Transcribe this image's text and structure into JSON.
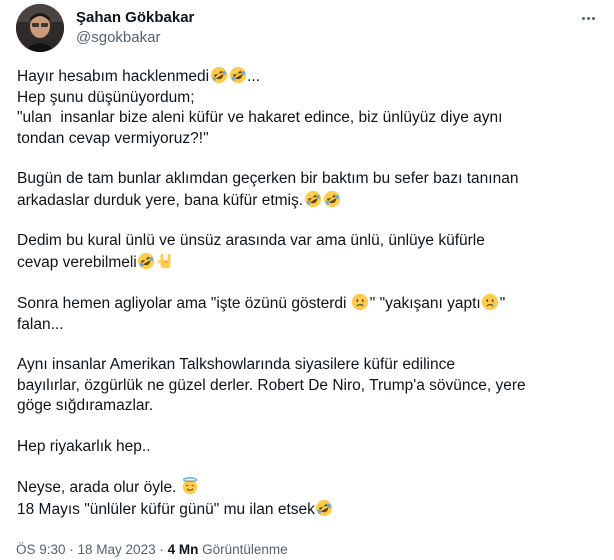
{
  "author": {
    "display_name": "Şahan Gökbakar",
    "handle": "@sgokbakar"
  },
  "tweet": {
    "paragraphs": [
      {
        "lines": [
          [
            {
              "t": "Hayır hesabım hacklenmedi"
            },
            {
              "e": "rofl-emoji"
            },
            {
              "e": "rofl-emoji"
            },
            {
              "t": "..."
            }
          ],
          [
            {
              "t": "Hep şunu düşünüyordum;"
            }
          ],
          [
            {
              "t": "\"ulan  insanlar bize aleni küfür ve hakaret edince, biz ünlüyüz diye aynı"
            }
          ],
          [
            {
              "t": "tondan cevap vermiyoruz?!\""
            }
          ]
        ]
      },
      {
        "lines": [
          [
            {
              "t": "Bugün de tam bunlar aklımdan geçerken bir baktım bu sefer bazı tanınan"
            }
          ],
          [
            {
              "t": "arkadaslar durduk yere, bana küfür etmiş."
            },
            {
              "e": "rofl-emoji"
            },
            {
              "e": "rofl-emoji"
            }
          ]
        ]
      },
      {
        "lines": [
          [
            {
              "t": "Dedim bu kural ünlü ve ünsüz arasında var ama ünlü, ünlüye küfürle"
            }
          ],
          [
            {
              "t": "cevap verebilmeli"
            },
            {
              "e": "rofl-emoji"
            },
            {
              "e": "rock-hand-emoji"
            }
          ]
        ]
      },
      {
        "lines": [
          [
            {
              "t": "Sonra hemen agliyolar ama \"işte özünü gösterdi "
            },
            {
              "e": "crying-face-emoji"
            },
            {
              "t": "\" \"yakışanı yaptı"
            },
            {
              "e": "crying-face-emoji"
            },
            {
              "t": "\""
            }
          ],
          [
            {
              "t": "falan..."
            }
          ]
        ]
      },
      {
        "lines": [
          [
            {
              "t": "Aynı insanlar Amerikan Talkshowlarında siyasilere küfür edilince"
            }
          ],
          [
            {
              "t": "bayılırlar, özgürlük ne güzel derler. Robert De Niro, Trump'a sövünce, yere"
            }
          ],
          [
            {
              "t": "göge sığdıramazlar."
            }
          ]
        ]
      },
      {
        "lines": [
          [
            {
              "t": "Hep riyakarlık hep.."
            }
          ]
        ]
      },
      {
        "lines": [
          [
            {
              "t": "Neyse, arada olur öyle. "
            },
            {
              "e": "smiling-halo-emoji"
            }
          ],
          [
            {
              "t": "18 Mayıs \"ünlüler küfür günü\" mu ilan etsek"
            },
            {
              "e": "rofl-emoji"
            }
          ]
        ]
      }
    ]
  },
  "meta": {
    "time": "ÖS 9:30",
    "separator": " · ",
    "date": "18 May 2023",
    "separator2": " · ",
    "views_count": "4 Mn",
    "views_label": "Görüntülenme"
  },
  "colors": {
    "text": "#0f1419",
    "secondary": "#536471",
    "emoji_face": "#ffcc4d"
  }
}
